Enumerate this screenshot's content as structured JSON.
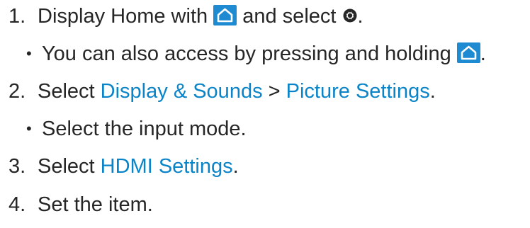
{
  "steps": [
    {
      "number": "1.",
      "before_icon": "Display Home with ",
      "icon1": "home-icon",
      "middle": " and select ",
      "icon2": "gear-icon",
      "after": "."
    },
    {
      "bullet": "•",
      "text": "You can also access by pressing and holding ",
      "icon": "home-icon",
      "after": "."
    },
    {
      "number": "2.",
      "prefix": "Select ",
      "link1": "Display & Sounds",
      "separator": " > ",
      "link2": "Picture Settings",
      "after": "."
    },
    {
      "bullet": "•",
      "text": "Select the input mode."
    },
    {
      "number": "3.",
      "prefix": "Select ",
      "link": "HDMI Settings",
      "after": "."
    },
    {
      "number": "4.",
      "text": "Set the item."
    }
  ],
  "colors": {
    "text": "#262626",
    "link": "#0a84c8",
    "icon_bg": "#1d8ad1"
  }
}
